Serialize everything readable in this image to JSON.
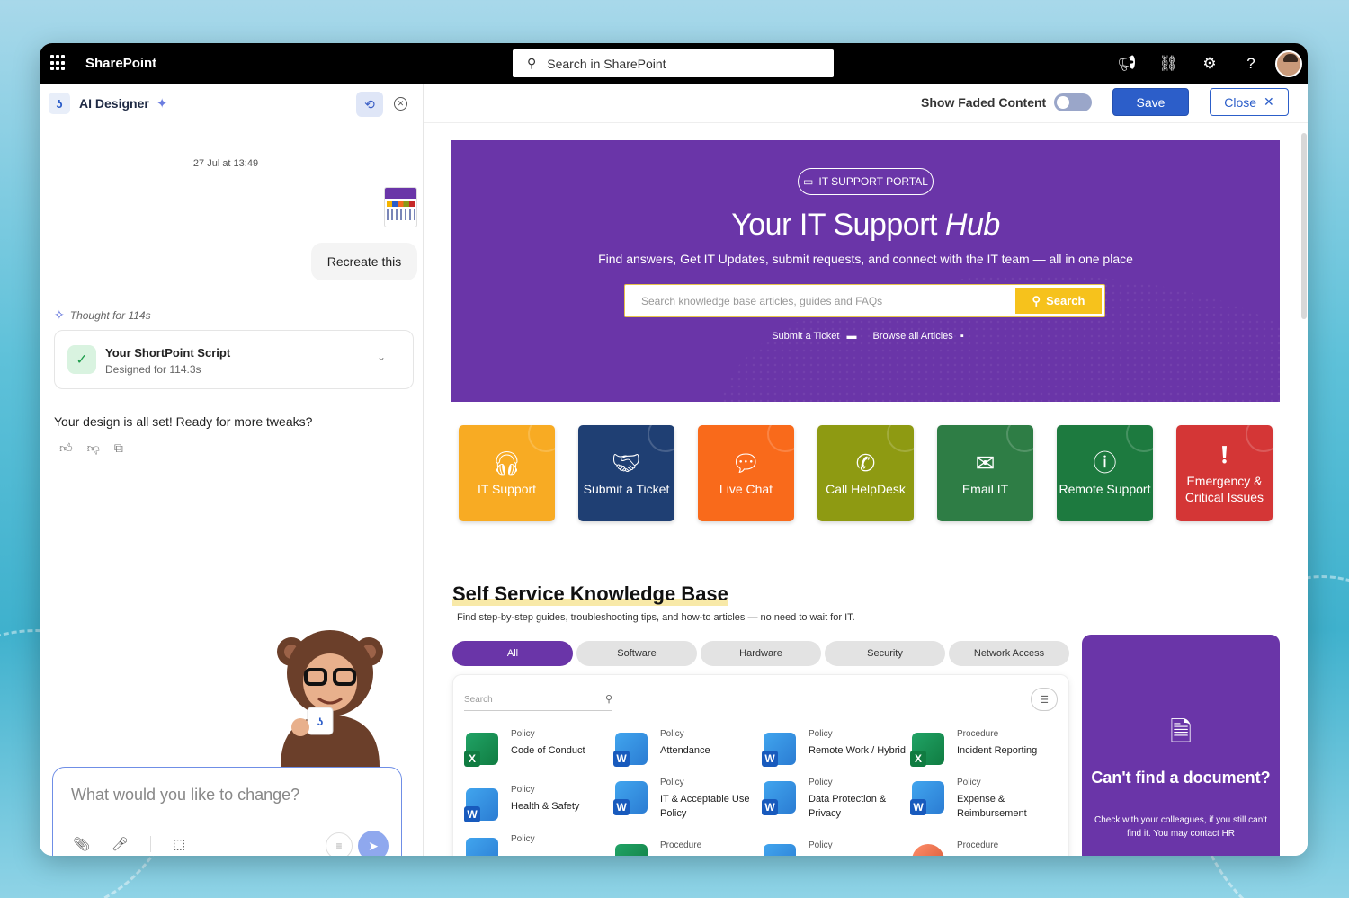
{
  "topbar": {
    "brand": "SharePoint",
    "search_placeholder": "Search in SharePoint"
  },
  "left_panel": {
    "title": "AI Designer",
    "date": "27 Jul at 13:49",
    "user_message": "Recreate this",
    "thought": "Thought for 114s",
    "card_title": "Your ShortPoint Script",
    "card_sub": "Designed for 114.3s",
    "assistant_message": "Your design is all set! Ready for more tweaks?",
    "input_placeholder": "What would you like to change?"
  },
  "toolbar": {
    "show_faded": "Show Faded Content",
    "save": "Save",
    "close": "Close"
  },
  "hero": {
    "pill": "IT SUPPORT PORTAL",
    "title_main": "Your IT Support",
    "title_italic": "Hub",
    "subtitle": "Find answers, Get IT Updates, submit requests, and connect with the IT team — all in one place",
    "search_placeholder": "Search knowledge base articles, guides and FAQs",
    "search_button": "Search",
    "link_ticket": "Submit a Ticket",
    "link_articles": "Browse all Articles"
  },
  "tiles": [
    {
      "label": "IT Support",
      "color": "#f8ab23",
      "icon": "headset-icon"
    },
    {
      "label": "Submit a Ticket",
      "color": "#1f3f73",
      "icon": "handshake-icon"
    },
    {
      "label": "Live Chat",
      "color": "#f96a1b",
      "icon": "chat-icon"
    },
    {
      "label": "Call HelpDesk",
      "color": "#8e9a12",
      "icon": "phone-icon"
    },
    {
      "label": "Email IT",
      "color": "#2e7d45",
      "icon": "mail-icon"
    },
    {
      "label": "Remote Support",
      "color": "#1d7a3f",
      "icon": "question-icon"
    },
    {
      "label": "Emergency & Critical Issues",
      "color": "#d43636",
      "icon": "alert-icon"
    }
  ],
  "knowledge_base": {
    "title": "Self Service Knowledge Base",
    "subtitle": "Find step-by-step guides, troubleshooting tips, and how-to articles — no need to wait for IT.",
    "tabs": [
      "All",
      "Software",
      "Hardware",
      "Security",
      "Network Access"
    ],
    "search_placeholder": "Search",
    "docs": [
      {
        "kind": "Policy",
        "title": "Code of Conduct",
        "type": "excel"
      },
      {
        "kind": "Policy",
        "title": "Attendance",
        "type": "word"
      },
      {
        "kind": "Policy",
        "title": "Remote Work / Hybrid",
        "type": "word"
      },
      {
        "kind": "Procedure",
        "title": "Incident Reporting",
        "type": "excel"
      },
      {
        "kind": "Policy",
        "title": "Health & Safety",
        "type": "word"
      },
      {
        "kind": "Policy",
        "title": "IT & Acceptable Use Policy",
        "type": "word"
      },
      {
        "kind": "Policy",
        "title": "Data Protection & Privacy",
        "type": "word"
      },
      {
        "kind": "Policy",
        "title": "Expense & Reimbursement",
        "type": "word"
      },
      {
        "kind": "Policy",
        "title": "",
        "type": "word"
      },
      {
        "kind": "Procedure",
        "title": "",
        "type": "excel"
      },
      {
        "kind": "Policy",
        "title": "",
        "type": "word"
      },
      {
        "kind": "Procedure",
        "title": "",
        "type": "powerpoint"
      }
    ]
  },
  "cta": {
    "title": "Can't find a document?",
    "subtitle": "Check with your colleagues, if you still can't find it. You may contact HR"
  }
}
